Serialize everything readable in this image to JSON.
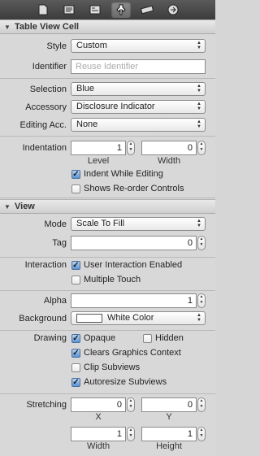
{
  "toolbar": {
    "tabs": [
      {
        "icon": "file-icon"
      },
      {
        "icon": "quick-help-icon"
      },
      {
        "icon": "identity-icon"
      },
      {
        "icon": "attributes-icon"
      },
      {
        "icon": "size-icon"
      },
      {
        "icon": "connections-icon"
      }
    ]
  },
  "table_view_cell": {
    "header": "Table View Cell",
    "style_label": "Style",
    "style_value": "Custom",
    "identifier_label": "Identifier",
    "identifier_placeholder": "Reuse Identifier",
    "selection_label": "Selection",
    "selection_value": "Blue",
    "accessory_label": "Accessory",
    "accessory_value": "Disclosure Indicator",
    "editing_acc_label": "Editing Acc.",
    "editing_acc_value": "None",
    "indentation_label": "Indentation",
    "level_value": "1",
    "level_label": "Level",
    "width_value": "0",
    "width_label": "Width",
    "indent_while_editing": "Indent While Editing",
    "shows_reorder": "Shows Re-order Controls"
  },
  "view": {
    "header": "View",
    "mode_label": "Mode",
    "mode_value": "Scale To Fill",
    "tag_label": "Tag",
    "tag_value": "0",
    "interaction_label": "Interaction",
    "user_interaction": "User Interaction Enabled",
    "multiple_touch": "Multiple Touch",
    "alpha_label": "Alpha",
    "alpha_value": "1",
    "background_label": "Background",
    "background_value": "White Color",
    "drawing_label": "Drawing",
    "opaque": "Opaque",
    "hidden": "Hidden",
    "clears_graphics": "Clears Graphics Context",
    "clip_subviews": "Clip Subviews",
    "autoresize_subviews": "Autoresize Subviews",
    "stretching_label": "Stretching",
    "x_value": "0",
    "x_label": "X",
    "y_value": "0",
    "y_label": "Y",
    "w_value": "1",
    "w_label": "Width",
    "h_value": "1",
    "h_label": "Height"
  },
  "colors": {
    "check_on": "#5d95d3",
    "panel": "#d8d8d8",
    "toolbar": "#3c3c3c"
  }
}
